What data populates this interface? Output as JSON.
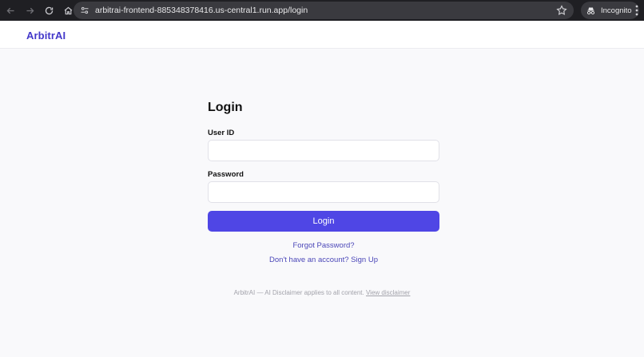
{
  "browser": {
    "url": "arbitrai-frontend-885348378416.us-central1.run.app/login",
    "incognito_label": "Incognito"
  },
  "header": {
    "brand": "ArbitrAI"
  },
  "login": {
    "title": "Login",
    "user_id_label": "User ID",
    "user_id_value": "",
    "password_label": "Password",
    "password_value": "",
    "submit_label": "Login",
    "forgot_password": "Forgot Password?",
    "signup": "Don't have an account? Sign Up"
  },
  "footer": {
    "disclaimer_text": "ArbitrAI — AI Disclaimer applies to all content.",
    "disclaimer_link": "View disclaimer"
  },
  "colors": {
    "brand": "#4338ca",
    "primary_button": "#4f46e5",
    "link": "#4b47b8"
  }
}
